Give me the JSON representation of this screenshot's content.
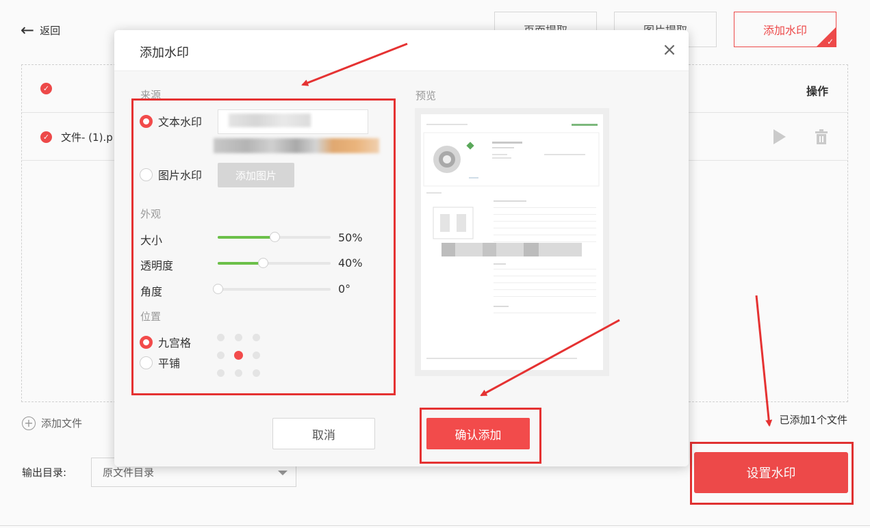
{
  "header": {
    "back_label": "返回",
    "tabs": [
      {
        "label": "页面提取",
        "active": false
      },
      {
        "label": "图片提取",
        "active": false
      },
      {
        "label": "添加水印",
        "active": true
      }
    ]
  },
  "file_list": {
    "op_header": "操作",
    "rows": [
      {
        "name": "文件- (1).p"
      }
    ]
  },
  "footer": {
    "add_file_label": "添加文件",
    "file_count": "已添加1个文件",
    "output_label": "输出目录:",
    "output_value": "原文件目录",
    "set_watermark_label": "设置水印"
  },
  "modal": {
    "title": "添加水印",
    "source_label": "来源",
    "text_watermark_label": "文本水印",
    "image_watermark_label": "图片水印",
    "add_image_label": "添加图片",
    "appearance_label": "外观",
    "sliders": [
      {
        "label": "大小",
        "value": 50,
        "display": "50%"
      },
      {
        "label": "透明度",
        "value": 40,
        "display": "40%"
      },
      {
        "label": "角度",
        "value": 0,
        "display": "0°"
      }
    ],
    "position_label": "位置",
    "grid_mode_label": "九宫格",
    "tile_mode_label": "平铺",
    "selected_cell": 4,
    "preview_label": "预览",
    "cancel_label": "取消",
    "confirm_label": "确认添加"
  },
  "colors": {
    "accent": "#f24b4b",
    "slider_fill": "#6cc04a",
    "annotation": "#e53232"
  }
}
